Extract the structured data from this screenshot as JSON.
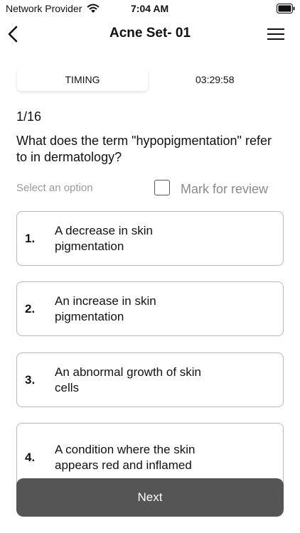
{
  "status_bar": {
    "carrier": "Network Provider",
    "time": "7:04 AM"
  },
  "nav": {
    "title": "Acne Set- 01"
  },
  "timing": {
    "label": "TIMING",
    "value": "03:29:58"
  },
  "question": {
    "counter": "1/16",
    "text": "What does the term \"hypopigmentation\" refer to in dermatology?"
  },
  "select_hint": "Select an option",
  "mark_review": "Mark for review",
  "options": [
    {
      "number": "1.",
      "text": "A decrease in skin pigmentation"
    },
    {
      "number": "2.",
      "text": "An increase in skin pigmentation"
    },
    {
      "number": "3.",
      "text": "An abnormal growth of skin cells"
    },
    {
      "number": "4.",
      "text": "A condition where the skin appears red and inflamed"
    }
  ],
  "next_label": "Next",
  "colors": {
    "button": "#555555",
    "border": "#b9b9b9",
    "hint": "#9a9a9a"
  },
  "icons": [
    "wifi-icon",
    "battery-icon",
    "back-chevron-icon",
    "hamburger-menu-icon",
    "checkbox-icon"
  ]
}
